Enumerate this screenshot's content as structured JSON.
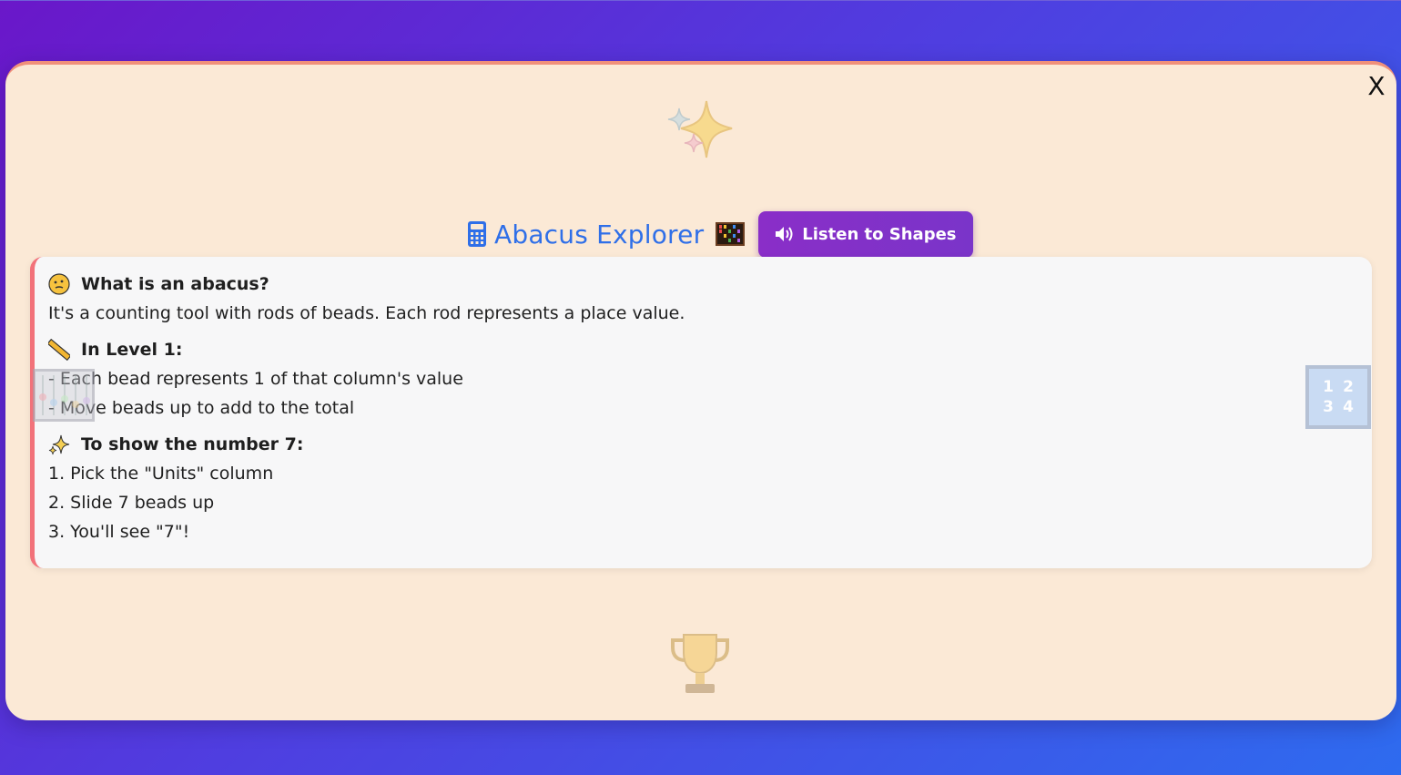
{
  "modal": {
    "close_label": "X",
    "title": "Abacus Explorer",
    "listen_label": "Listen to Shapes",
    "accent_color": "#2f6fe8",
    "button_color": "#8a2ec8",
    "card_border_color": "#f2727a"
  },
  "content": {
    "q_heading": "What is an abacus?",
    "q_answer": "It's a counting tool with rods of beads. Each rod represents a place value.",
    "level_heading": "In Level 1:",
    "level_items": [
      "- Each bead represents 1 of that column's value",
      "- Move beads up to add to the total"
    ],
    "show_heading": "To show the number 7:",
    "steps": [
      "1. Pick the \"Units\" column",
      "2. Slide 7 beads up",
      "3. You'll see \"7\"!"
    ]
  },
  "decor": {
    "numbers": [
      "1",
      "2",
      "3",
      "4"
    ],
    "icons": [
      "sparkles-icon",
      "trophy-icon",
      "abacus-icon",
      "numbers-icon",
      "calculator-icon",
      "speaker-icon",
      "thinking-face-icon",
      "ruler-icon",
      "sparkle-icon"
    ]
  }
}
